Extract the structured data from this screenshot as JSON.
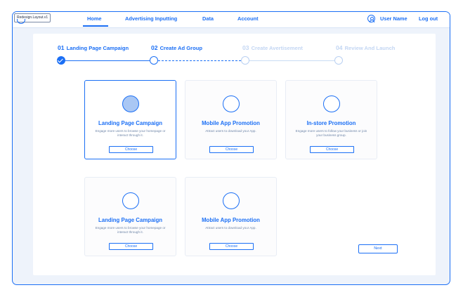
{
  "badge": {
    "label": "Redesign.Layout.v1"
  },
  "nav": {
    "items": [
      {
        "label": "Home"
      },
      {
        "label": "Advertising Inputting"
      },
      {
        "label": "Data"
      },
      {
        "label": "Account"
      }
    ],
    "active": "Home",
    "user_name": "User Name",
    "logout": "Log out"
  },
  "steps": [
    {
      "num": "01",
      "label": "Landing Page Campaign",
      "state": "done"
    },
    {
      "num": "02",
      "label": "Create Ad Group",
      "state": "current"
    },
    {
      "num": "03",
      "label": "Create Avertisement",
      "state": "todo"
    },
    {
      "num": "04",
      "label": "Review And Launch",
      "state": "todo"
    }
  ],
  "cards": [
    {
      "title": "Landing Page Campaign",
      "desc": "Engage more users to browse your homepage or interact through it.",
      "button": "Choose",
      "selected": true
    },
    {
      "title": "Mobile App Promotion",
      "desc": "Attract users to download your App.",
      "button": "Choose",
      "selected": false
    },
    {
      "title": "In-store Promotion",
      "desc": "Engage more users to follow your business or join your business group.",
      "button": "Choose",
      "selected": false
    },
    {
      "title": "Landing Page Campaign",
      "desc": "Engage more users to browse your homepage or interact through it.",
      "button": "Choose",
      "selected": false
    },
    {
      "title": "Mobile App Promotion",
      "desc": "Attract users to download your App.",
      "button": "Choose",
      "selected": false
    }
  ],
  "next_label": "Next",
  "colors": {
    "accent": "#1b6ff5",
    "inactive": "#c3d6f3",
    "background": "#eef3fb"
  }
}
